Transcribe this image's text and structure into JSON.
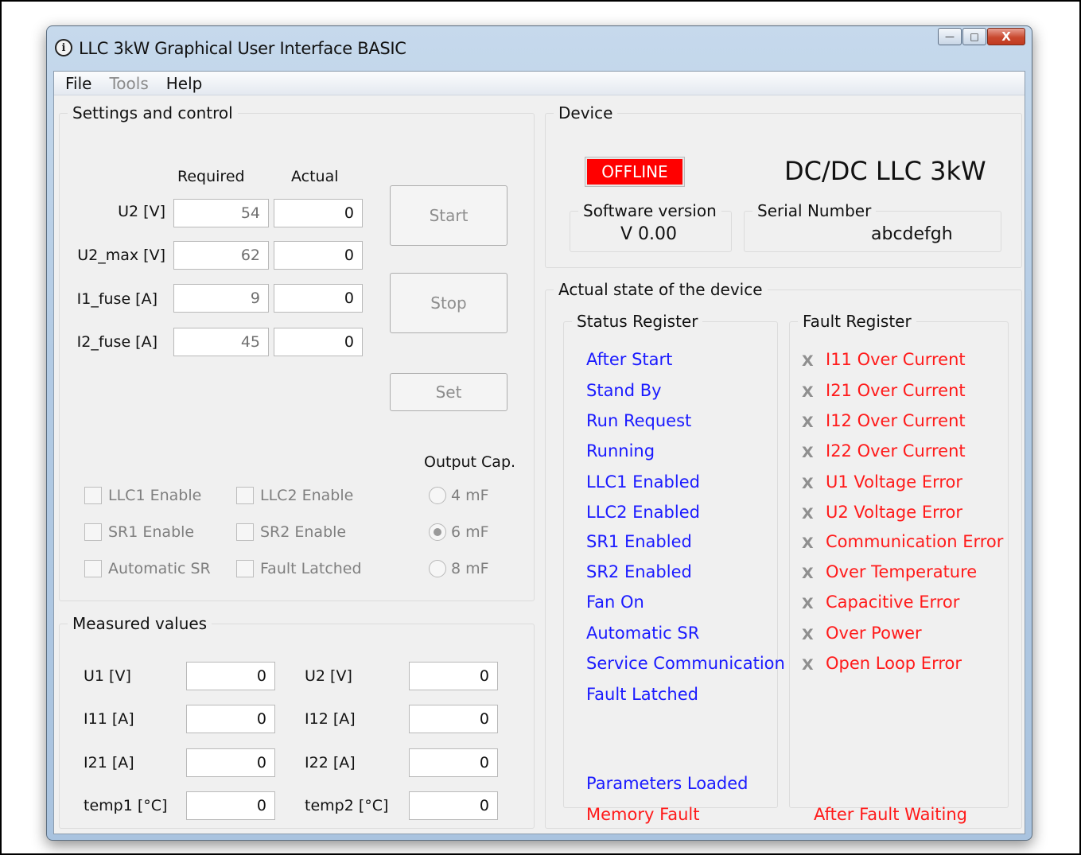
{
  "window": {
    "title": "LLC 3kW Graphical User Interface BASIC",
    "controls": {
      "minimize": "—",
      "maximize": "□",
      "close": "X"
    }
  },
  "menu": {
    "file": "File",
    "tools": "Tools",
    "help": "Help"
  },
  "settings": {
    "legend": "Settings and control",
    "col_required": "Required",
    "col_actual": "Actual",
    "rows": [
      {
        "label": "U2 [V]",
        "required": "54",
        "actual": "0"
      },
      {
        "label": "U2_max [V]",
        "required": "62",
        "actual": "0"
      },
      {
        "label": "I1_fuse [A]",
        "required": "9",
        "actual": "0"
      },
      {
        "label": "I2_fuse [A]",
        "required": "45",
        "actual": "0"
      }
    ],
    "start_label": "Start",
    "stop_label": "Stop",
    "set_label": "Set",
    "checkboxes": [
      {
        "label": "LLC1 Enable",
        "checked": false
      },
      {
        "label": "LLC2 Enable",
        "checked": false
      },
      {
        "label": "SR1 Enable",
        "checked": false
      },
      {
        "label": "SR2 Enable",
        "checked": false
      },
      {
        "label": "Automatic SR",
        "checked": false
      },
      {
        "label": "Fault Latched",
        "checked": false
      }
    ],
    "output_cap_label": "Output Cap.",
    "output_cap_options": [
      "4 mF",
      "6 mF",
      "8 mF"
    ],
    "output_cap_selected": "6 mF"
  },
  "measured": {
    "legend": "Measured values",
    "rows": [
      {
        "left_label": "U1 [V]",
        "left_value": "0",
        "right_label": "U2 [V]",
        "right_value": "0"
      },
      {
        "left_label": "I11 [A]",
        "left_value": "0",
        "right_label": "I12 [A]",
        "right_value": "0"
      },
      {
        "left_label": "I21 [A]",
        "left_value": "0",
        "right_label": "I22 [A]",
        "right_value": "0"
      },
      {
        "left_label": "temp1 [°C]",
        "left_value": "0",
        "right_label": "temp2 [°C]",
        "right_value": "0"
      }
    ]
  },
  "device": {
    "legend": "Device",
    "status": "OFFLINE",
    "status_color": "#ff0000",
    "name": "DC/DC LLC 3kW",
    "software_version_legend": "Software version",
    "software_version": "V 0.00",
    "serial_legend": "Serial Number",
    "serial": "abcdefgh"
  },
  "actual_state": {
    "legend": "Actual state of the device",
    "status_register": {
      "legend": "Status Register",
      "items": [
        "After Start",
        "Stand By",
        "Run Request",
        "Running",
        "LLC1 Enabled",
        "LLC2 Enabled",
        "SR1 Enabled",
        "SR2 Enabled",
        "Fan On",
        "Automatic SR",
        "Service Communication",
        "Fault Latched"
      ],
      "parameters_loaded": "Parameters Loaded",
      "memory_fault": "Memory Fault",
      "item_color": "#1a1aff",
      "fault_color": "#ff1a1a"
    },
    "fault_register": {
      "legend": "Fault Register",
      "marker": "X",
      "items": [
        "I11 Over Current",
        "I21 Over Current",
        "I12 Over Current",
        "I22 Over Current",
        "U1 Voltage Error",
        "U2 Voltage Error",
        "Communication Error",
        "Over Temperature",
        "Capacitive Error",
        "Over Power",
        "Open Loop Error"
      ],
      "after_fault_waiting": "After Fault Waiting",
      "item_color": "#ff1a1a"
    }
  }
}
